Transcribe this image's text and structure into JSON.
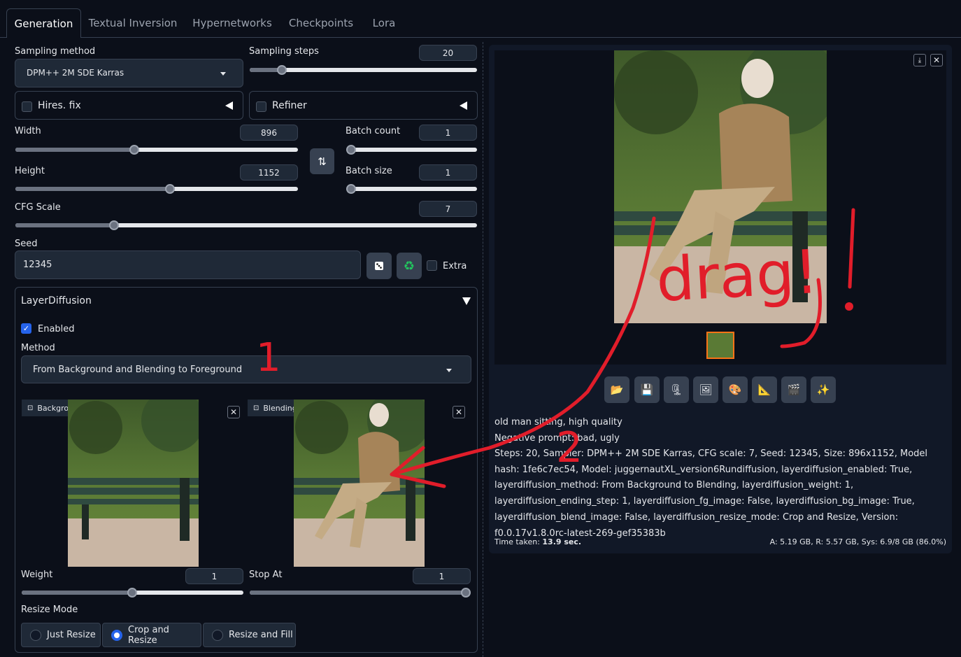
{
  "tabs": [
    "Generation",
    "Textual Inversion",
    "Hypernetworks",
    "Checkpoints",
    "Lora"
  ],
  "sampling": {
    "method_label": "Sampling method",
    "method_value": "DPM++ 2M SDE Karras",
    "steps_label": "Sampling steps",
    "steps_value": "20"
  },
  "hires": {
    "label": "Hires. fix"
  },
  "refiner": {
    "label": "Refiner"
  },
  "width": {
    "label": "Width",
    "value": "896"
  },
  "height": {
    "label": "Height",
    "value": "1152"
  },
  "batch_count": {
    "label": "Batch count",
    "value": "1"
  },
  "batch_size": {
    "label": "Batch size",
    "value": "1"
  },
  "cfg": {
    "label": "CFG Scale",
    "value": "7"
  },
  "seed": {
    "label": "Seed",
    "value": "12345",
    "extra_label": "Extra"
  },
  "layerdiffusion": {
    "title": "LayerDiffusion",
    "enabled_label": "Enabled",
    "method_label": "Method",
    "method_value": "From Background and Blending to Foreground",
    "background_label": "Background",
    "blending_label": "Blending",
    "weight_label": "Weight",
    "weight_value": "1",
    "stop_label": "Stop At",
    "stop_value": "1",
    "resize_label": "Resize Mode",
    "resize_options": [
      "Just Resize",
      "Crop and Resize",
      "Resize and Fill"
    ]
  },
  "output": {
    "prompt": "old man sitting, high quality",
    "negative": "Negative prompt: bad, ugly",
    "params": "Steps: 20, Sampler: DPM++ 2M SDE Karras, CFG scale: 7, Seed: 12345, Size: 896x1152, Model hash: 1fe6c7ec54, Model: juggernautXL_version6Rundiffusion, layerdiffusion_enabled: True, layerdiffusion_method: From Background to Blending, layerdiffusion_weight: 1, layerdiffusion_ending_step: 1, layerdiffusion_fg_image: False, layerdiffusion_bg_image: True, layerdiffusion_blend_image: False, layerdiffusion_resize_mode: Crop and Resize, Version: f0.0.17v1.8.0rc-latest-269-gef35383b",
    "time_label": "Time taken:",
    "time_value": "13.9 sec.",
    "mem": "A: 5.19 GB, R: 5.57 GB, Sys: 6.9/8 GB (86.0%)"
  },
  "annotation": {
    "text": "drag!",
    "number_1": "1",
    "number_2": "2"
  },
  "colors": {
    "accent": "#2563eb",
    "annotation": "#e11d2a",
    "bg": "#0b0f19"
  }
}
